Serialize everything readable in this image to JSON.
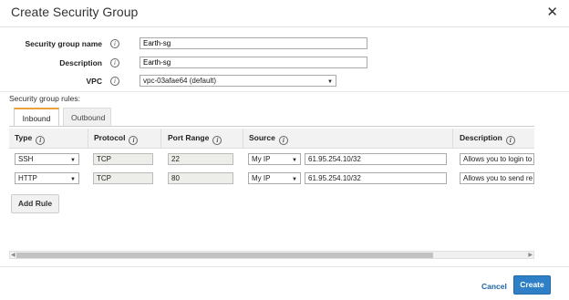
{
  "dialog": {
    "title": "Create Security Group",
    "close_glyph": "✕"
  },
  "form": {
    "name_label": "Security group name",
    "name_value": "Earth-sg",
    "description_label": "Description",
    "description_value": "Earth-sg",
    "vpc_label": "VPC",
    "vpc_value": "vpc-03afae64 (default)",
    "info_glyph": "i"
  },
  "rules": {
    "label": "Security group rules:",
    "tabs": [
      {
        "label": "Inbound",
        "active": true
      },
      {
        "label": "Outbound",
        "active": false
      }
    ],
    "columns": [
      "Type",
      "Protocol",
      "Port Range",
      "Source",
      "Description"
    ],
    "rows": [
      {
        "type": "SSH",
        "protocol": "TCP",
        "port_range": "22",
        "source_type": "My IP",
        "source_cidr": "61.95.254.10/32",
        "description": "Allows you to login to"
      },
      {
        "type": "HTTP",
        "protocol": "TCP",
        "port_range": "80",
        "source_type": "My IP",
        "source_cidr": "61.95.254.10/32",
        "description": "Allows you to send re"
      }
    ],
    "add_rule_label": "Add Rule"
  },
  "footer": {
    "cancel_label": "Cancel",
    "create_label": "Create"
  },
  "colors": {
    "accent_tab": "#e9a13b",
    "primary_button": "#2f7fc6",
    "link": "#1b63a8"
  }
}
